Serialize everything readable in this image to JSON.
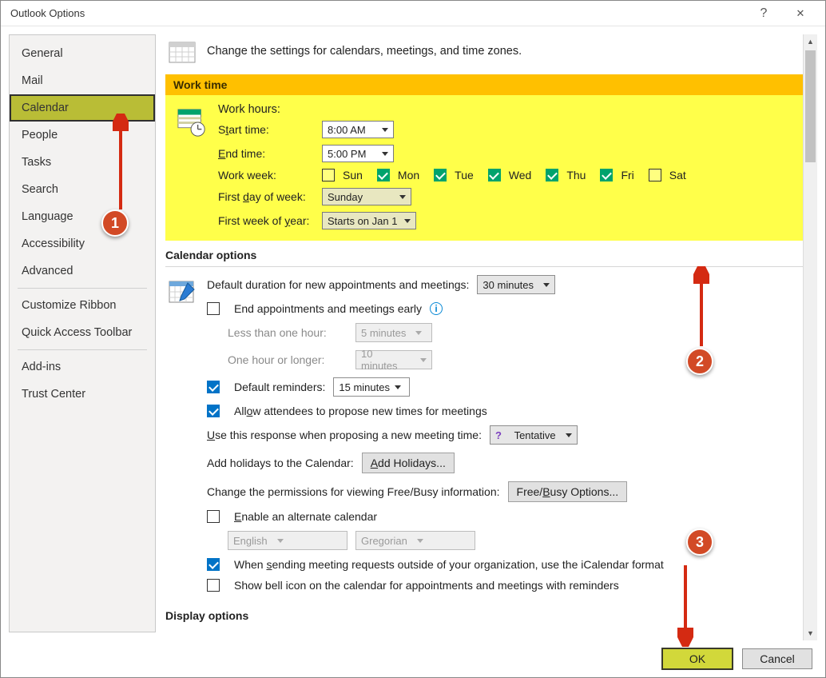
{
  "window": {
    "title": "Outlook Options"
  },
  "sidebar": {
    "items": [
      {
        "label": "General"
      },
      {
        "label": "Mail"
      },
      {
        "label": "Calendar",
        "selected": true
      },
      {
        "label": "People"
      },
      {
        "label": "Tasks"
      },
      {
        "label": "Search"
      },
      {
        "label": "Language"
      },
      {
        "label": "Accessibility"
      },
      {
        "label": "Advanced"
      }
    ],
    "items2": [
      {
        "label": "Customize Ribbon"
      },
      {
        "label": "Quick Access Toolbar"
      }
    ],
    "items3": [
      {
        "label": "Add-ins"
      },
      {
        "label": "Trust Center"
      }
    ]
  },
  "header": {
    "text": "Change the settings for calendars, meetings, and time zones."
  },
  "work_time": {
    "banner": "Work time",
    "work_hours_label": "Work hours:",
    "start_label": "Start time:",
    "start_value": "8:00 AM",
    "end_label": "End time:",
    "end_value": "5:00 PM",
    "work_week_label": "Work week:",
    "days": [
      {
        "abbr": "Sun",
        "checked": false
      },
      {
        "abbr": "Mon",
        "checked": true
      },
      {
        "abbr": "Tue",
        "checked": true
      },
      {
        "abbr": "Wed",
        "checked": true
      },
      {
        "abbr": "Thu",
        "checked": true
      },
      {
        "abbr": "Fri",
        "checked": true
      },
      {
        "abbr": "Sat",
        "checked": false
      }
    ],
    "first_day_label": "First day of week:",
    "first_day_value": "Sunday",
    "first_week_label": "First week of year:",
    "first_week_value": "Starts on Jan 1"
  },
  "calendar_options": {
    "title": "Calendar options",
    "default_duration_label": "Default duration for new appointments and meetings:",
    "default_duration_value": "30 minutes",
    "end_early_label": "End appointments and meetings early",
    "lt_hour_label": "Less than one hour:",
    "lt_hour_value": "5 minutes",
    "ge_hour_label": "One hour or longer:",
    "ge_hour_value": "10 minutes",
    "default_reminders_label": "Default reminders:",
    "default_reminders_value": "15 minutes",
    "allow_propose_label": "Allow attendees to propose new times for meetings",
    "use_response_label": "Use this response when proposing a new meeting time:",
    "use_response_value": "Tentative",
    "add_holidays_label": "Add holidays to the Calendar:",
    "add_holidays_btn": "Add Holidays...",
    "freebusy_label": "Change the permissions for viewing Free/Busy information:",
    "freebusy_btn": "Free/Busy Options...",
    "enable_alt_label": "Enable an alternate calendar",
    "alt_lang": "English",
    "alt_sys": "Gregorian",
    "icalendar_label": "When sending meeting requests outside of your organization, use the iCalendar format",
    "bell_icon_label": "Show bell icon on the calendar for appointments and meetings with reminders"
  },
  "display_options": {
    "title": "Display options"
  },
  "buttons": {
    "ok": "OK",
    "cancel": "Cancel"
  },
  "callouts": {
    "b1": "1",
    "b2": "2",
    "b3": "3"
  }
}
